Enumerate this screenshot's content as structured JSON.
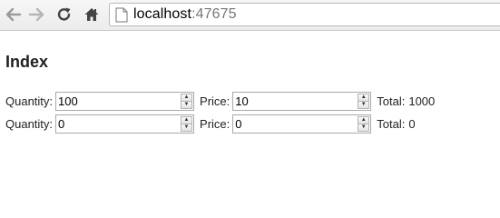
{
  "browser": {
    "url_host": "localhost",
    "url_port": ":47675",
    "icons": [
      "back-arrow-icon",
      "forward-arrow-icon",
      "reload-icon",
      "home-icon",
      "page-icon"
    ]
  },
  "page": {
    "title": "Index",
    "rows": [
      {
        "quantity_label": "Quantity:",
        "quantity": "100",
        "price_label": "Price:",
        "price": "10",
        "total_label": "Total:",
        "total": "1000"
      },
      {
        "quantity_label": "Quantity:",
        "quantity": "0",
        "price_label": "Price:",
        "price": "0",
        "total_label": "Total:",
        "total": "0"
      }
    ]
  }
}
